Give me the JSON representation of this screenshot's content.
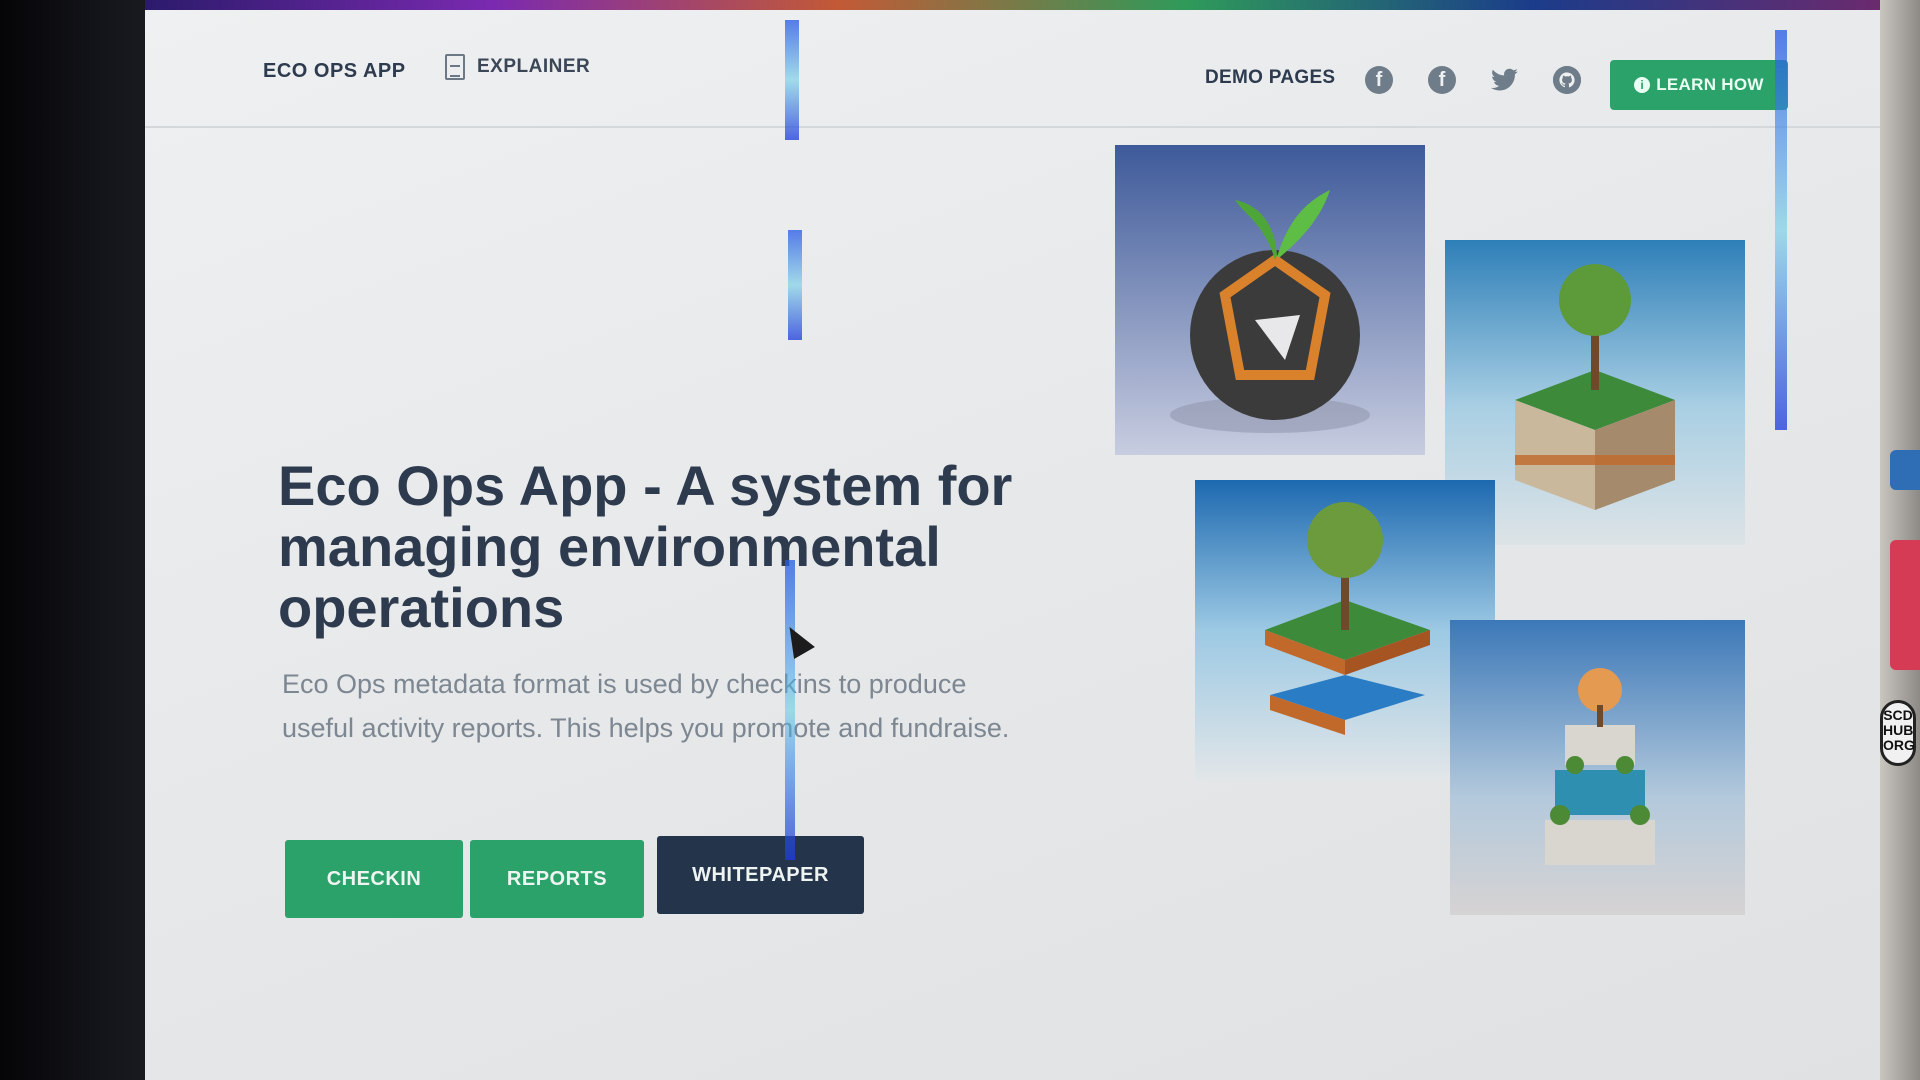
{
  "nav": {
    "brand": "ECO OPS APP",
    "explainer": "EXPLAINER",
    "demo_pages": "DEMO PAGES",
    "social_icons": [
      "facebook-icon",
      "facebook-icon",
      "twitter-icon",
      "github-icon"
    ],
    "learn_how": "LEARN HOW"
  },
  "hero": {
    "title": "Eco Ops App - A system for managing environmental operations",
    "text": "Eco Ops metadata format is used by checkins to produce useful activity reports. This helps you promote and fundraise."
  },
  "buttons": {
    "checkin": "CHECKIN",
    "reports": "REPORTS",
    "whitepaper": "WHITEPAPER"
  },
  "gallery": [
    "geodesic-planter-image",
    "layered-soil-tree-image",
    "floating-island-tree-image",
    "terraced-tower-image"
  ],
  "side_badge": "SCD HUB ORG",
  "colors": {
    "accent_green": "#2aa26a",
    "dark_navy": "#24344a",
    "heading": "#2e3b4e",
    "body_text": "#7d8792"
  }
}
